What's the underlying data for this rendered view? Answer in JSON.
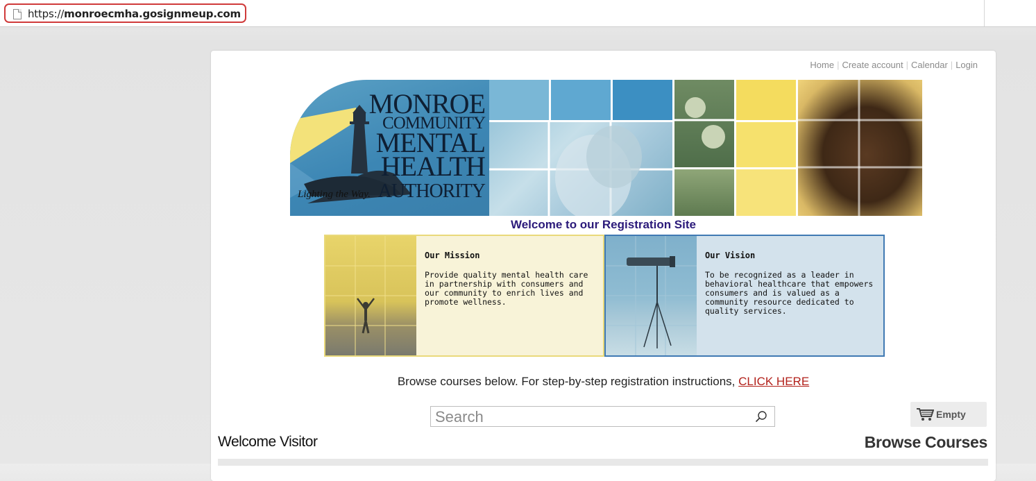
{
  "browser": {
    "url_prefix": "https://",
    "url_host": "monroecmha.gosignmeup.com"
  },
  "topnav": {
    "home": "Home",
    "create_account": "Create account",
    "calendar": "Calendar",
    "login": "Login"
  },
  "logo": {
    "line1": "MONROE",
    "line2": "COMMUNITY",
    "line3": "MENTAL",
    "line4": "HEALTH",
    "line5": "AUTHORITY",
    "tagline": "Lighting the Way."
  },
  "welcome_heading": "Welcome to our Registration Site",
  "mission": {
    "title": "Our Mission",
    "body": "Provide quality mental health care in partnership with consumers and our community to enrich lives and promote wellness."
  },
  "vision": {
    "title": "Our Vision",
    "body": "To be recognized as a leader in behavioral healthcare that empowers consumers and is valued as a community resource dedicated to quality services."
  },
  "browse_line": {
    "text": "Browse courses below. For step-by-step registration instructions, ",
    "link": "CLICK HERE"
  },
  "search": {
    "placeholder": "Search"
  },
  "cart": {
    "label": "Empty"
  },
  "welcome_visitor": "Welcome Visitor",
  "browse_courses": "Browse Courses",
  "colors": {
    "highlight_border": "#d03a3a",
    "heading_blue": "#2b1a7a",
    "link_red": "#b2201a",
    "mission_bg": "#f8f3d8",
    "vision_bg": "#d3e2ec"
  }
}
